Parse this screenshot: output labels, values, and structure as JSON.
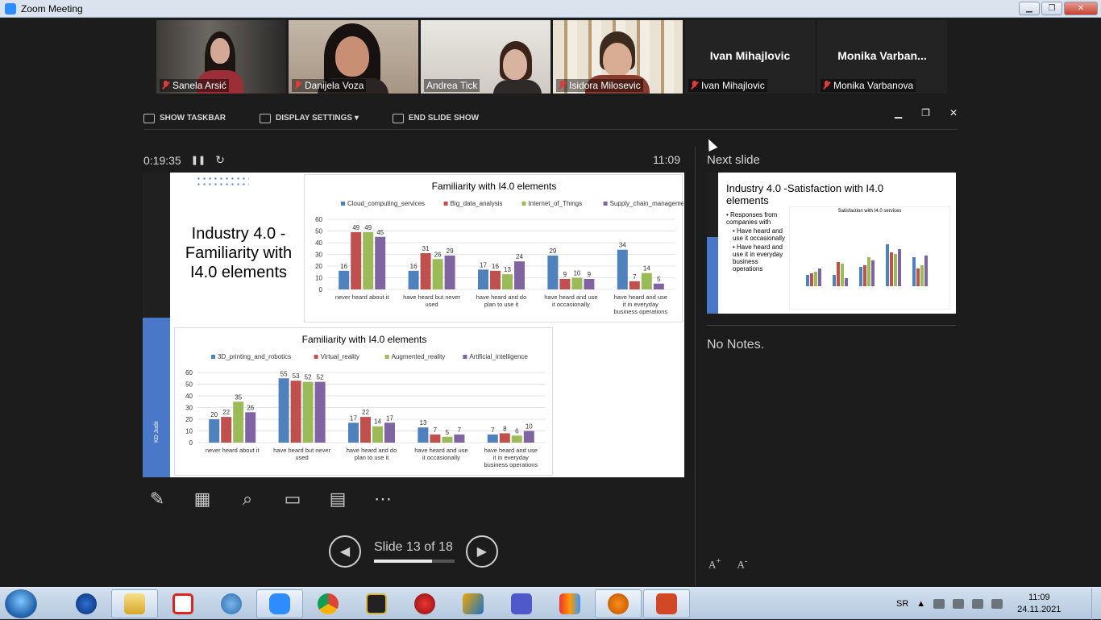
{
  "window": {
    "title": "Zoom Meeting",
    "minimize": "▁",
    "restore": "❐",
    "close": "✕"
  },
  "participants": [
    {
      "name": "Sanela Arsić",
      "muted": true,
      "video": true
    },
    {
      "name": "Danijela Voza",
      "muted": true,
      "video": true
    },
    {
      "name": "Andrea Tick",
      "muted": false,
      "video": true,
      "active": true
    },
    {
      "name": "Isidora Milosevic",
      "muted": true,
      "video": true
    },
    {
      "name": "Ivan Mihajlovic",
      "display_name": "Ivan Mihajlovic",
      "muted": true,
      "video": false
    },
    {
      "name": "Monika Varbanova",
      "display_name": "Monika  Varban...",
      "muted": true,
      "video": false
    }
  ],
  "presenter_toolbar": {
    "show_taskbar": "SHOW TASKBAR",
    "display_settings": "DISPLAY SETTINGS ▾",
    "end_slide_show": "END SLIDE SHOW"
  },
  "presenter": {
    "elapsed": "0:19:35",
    "clock": "11:09",
    "slide_label": "Slide 13 of 18",
    "slide_progress": 0.72,
    "next_slide_header": "Next slide",
    "notes": "No Notes."
  },
  "slide": {
    "title": "Industry 4.0 -\nFamiliarity with I4.0 elements",
    "author": "KD Judit"
  },
  "chart_data": [
    {
      "type": "bar",
      "title": "Familiarity with I4.0 elements",
      "categories": [
        "never heard about it",
        "have heard but never used",
        "have heard and do plan to use it",
        "have heard and use it occasionally",
        "have heard and use it in everyday business operations"
      ],
      "ylim": [
        0,
        60
      ],
      "yticks": [
        0,
        10,
        20,
        30,
        40,
        50,
        60
      ],
      "legend": "top",
      "series": [
        {
          "name": "Cloud_computing_services",
          "color": "#4f81bd",
          "values": [
            16,
            16,
            17,
            29,
            34
          ]
        },
        {
          "name": "Big_data_analysis",
          "color": "#c0504d",
          "values": [
            49,
            31,
            16,
            9,
            7
          ]
        },
        {
          "name": "Internet_of_Things",
          "color": "#9bbb59",
          "values": [
            49,
            26,
            13,
            10,
            14
          ]
        },
        {
          "name": "Supply_chain_management",
          "color": "#8064a2",
          "values": [
            45,
            29,
            24,
            9,
            5
          ]
        }
      ]
    },
    {
      "type": "bar",
      "title": "Familiarity with I4.0 elements",
      "categories": [
        "never heard about it",
        "have heard but never used",
        "have heard and do plan to use it",
        "have heard and use it occasionally",
        "have heard and use it in everyday business operations"
      ],
      "ylim": [
        0,
        60
      ],
      "yticks": [
        0,
        10,
        20,
        30,
        40,
        50,
        60
      ],
      "legend": "top",
      "series": [
        {
          "name": "3D_printing_and_robotics",
          "color": "#4f81bd",
          "values": [
            20,
            55,
            17,
            13,
            7
          ]
        },
        {
          "name": "Virtual_reality",
          "color": "#c0504d",
          "values": [
            22,
            53,
            22,
            7,
            8
          ]
        },
        {
          "name": "Augmented_reality",
          "color": "#9bbb59",
          "values": [
            35,
            52,
            14,
            5,
            6
          ]
        },
        {
          "name": "Artificial_intelligence",
          "color": "#8064a2",
          "values": [
            26,
            52,
            17,
            7,
            10
          ]
        }
      ]
    }
  ],
  "next_slide": {
    "title": "Industry 4.0 -Satisfaction with I4.0 elements",
    "bullet": "Responses from companies with",
    "sub_bullets": [
      "Have heard and use it occasionally",
      "Have heard and use it in everyday business operations"
    ],
    "chart_title": "Satisfaction with I4.0 services"
  },
  "taskbar": {
    "apps": [
      "start",
      "ccleaner",
      "explorer",
      "acrobat",
      "mathtype",
      "zoom",
      "chrome",
      "moviemaker",
      "virus",
      "kaspersky",
      "teams",
      "winrar",
      "avast",
      "powerpoint"
    ],
    "lang": "SR",
    "time": "11:09",
    "date": "24.11.2021"
  }
}
